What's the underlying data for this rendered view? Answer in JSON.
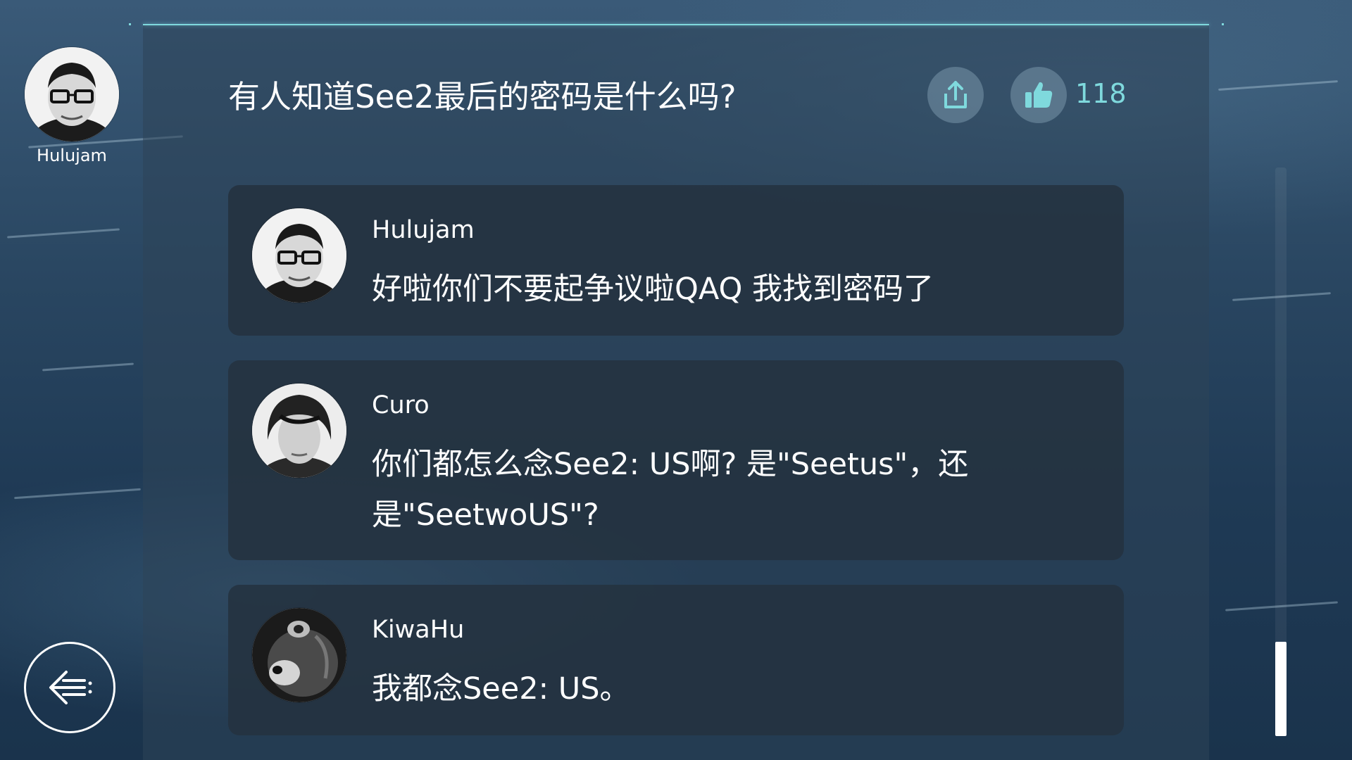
{
  "post": {
    "author_name": "Hulujam",
    "title": "有人知道See2最后的密码是什么吗?",
    "like_count": "118"
  },
  "comments": [
    {
      "name": "Hulujam",
      "text": "好啦你们不要起争议啦QAQ 我找到密码了"
    },
    {
      "name": "Curo",
      "text": "你们都怎么念See2: US啊? 是\"Seetus\"，还是\"SeetwoUS\"?"
    },
    {
      "name": "KiwaHu",
      "text": "我都念See2: US。"
    }
  ],
  "icons": {
    "share": "share-icon",
    "like": "thumbs-up-icon",
    "back": "back-arrow-icon"
  },
  "colors": {
    "accent": "#7fd9dd",
    "card": "#243240",
    "text": "#ffffff"
  },
  "scroll": {
    "position": 1.0
  }
}
